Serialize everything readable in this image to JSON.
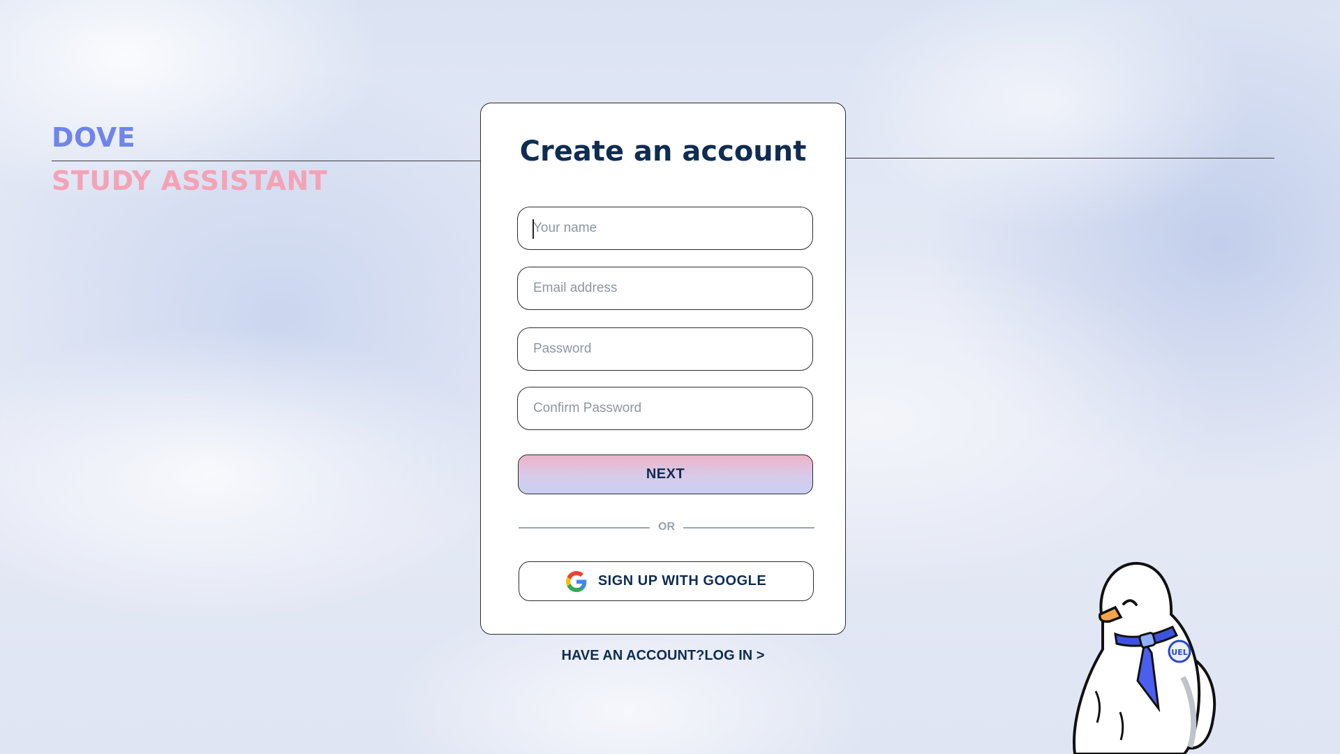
{
  "brand": {
    "name": "DOVE",
    "subtitle": "STUDY ASSISTANT"
  },
  "signup": {
    "title": "Create an account",
    "name_placeholder": "Your name",
    "email_placeholder": "Email address",
    "password_placeholder": "Password",
    "confirm_placeholder": "Confirm Password",
    "next_label": "NEXT",
    "divider_text": "OR",
    "google_label": "SIGN UP WITH GOOGLE",
    "google_icon": "google-g-icon"
  },
  "footer": {
    "login_text": "HAVE AN ACCOUNT?LOG IN >"
  },
  "mascot": {
    "badge_text": "UEL",
    "icon": "dove-mascot"
  },
  "colors": {
    "brand_blue": "#6f84ec",
    "brand_pink": "#f4a3b6",
    "text_navy": "#0f2d52"
  }
}
